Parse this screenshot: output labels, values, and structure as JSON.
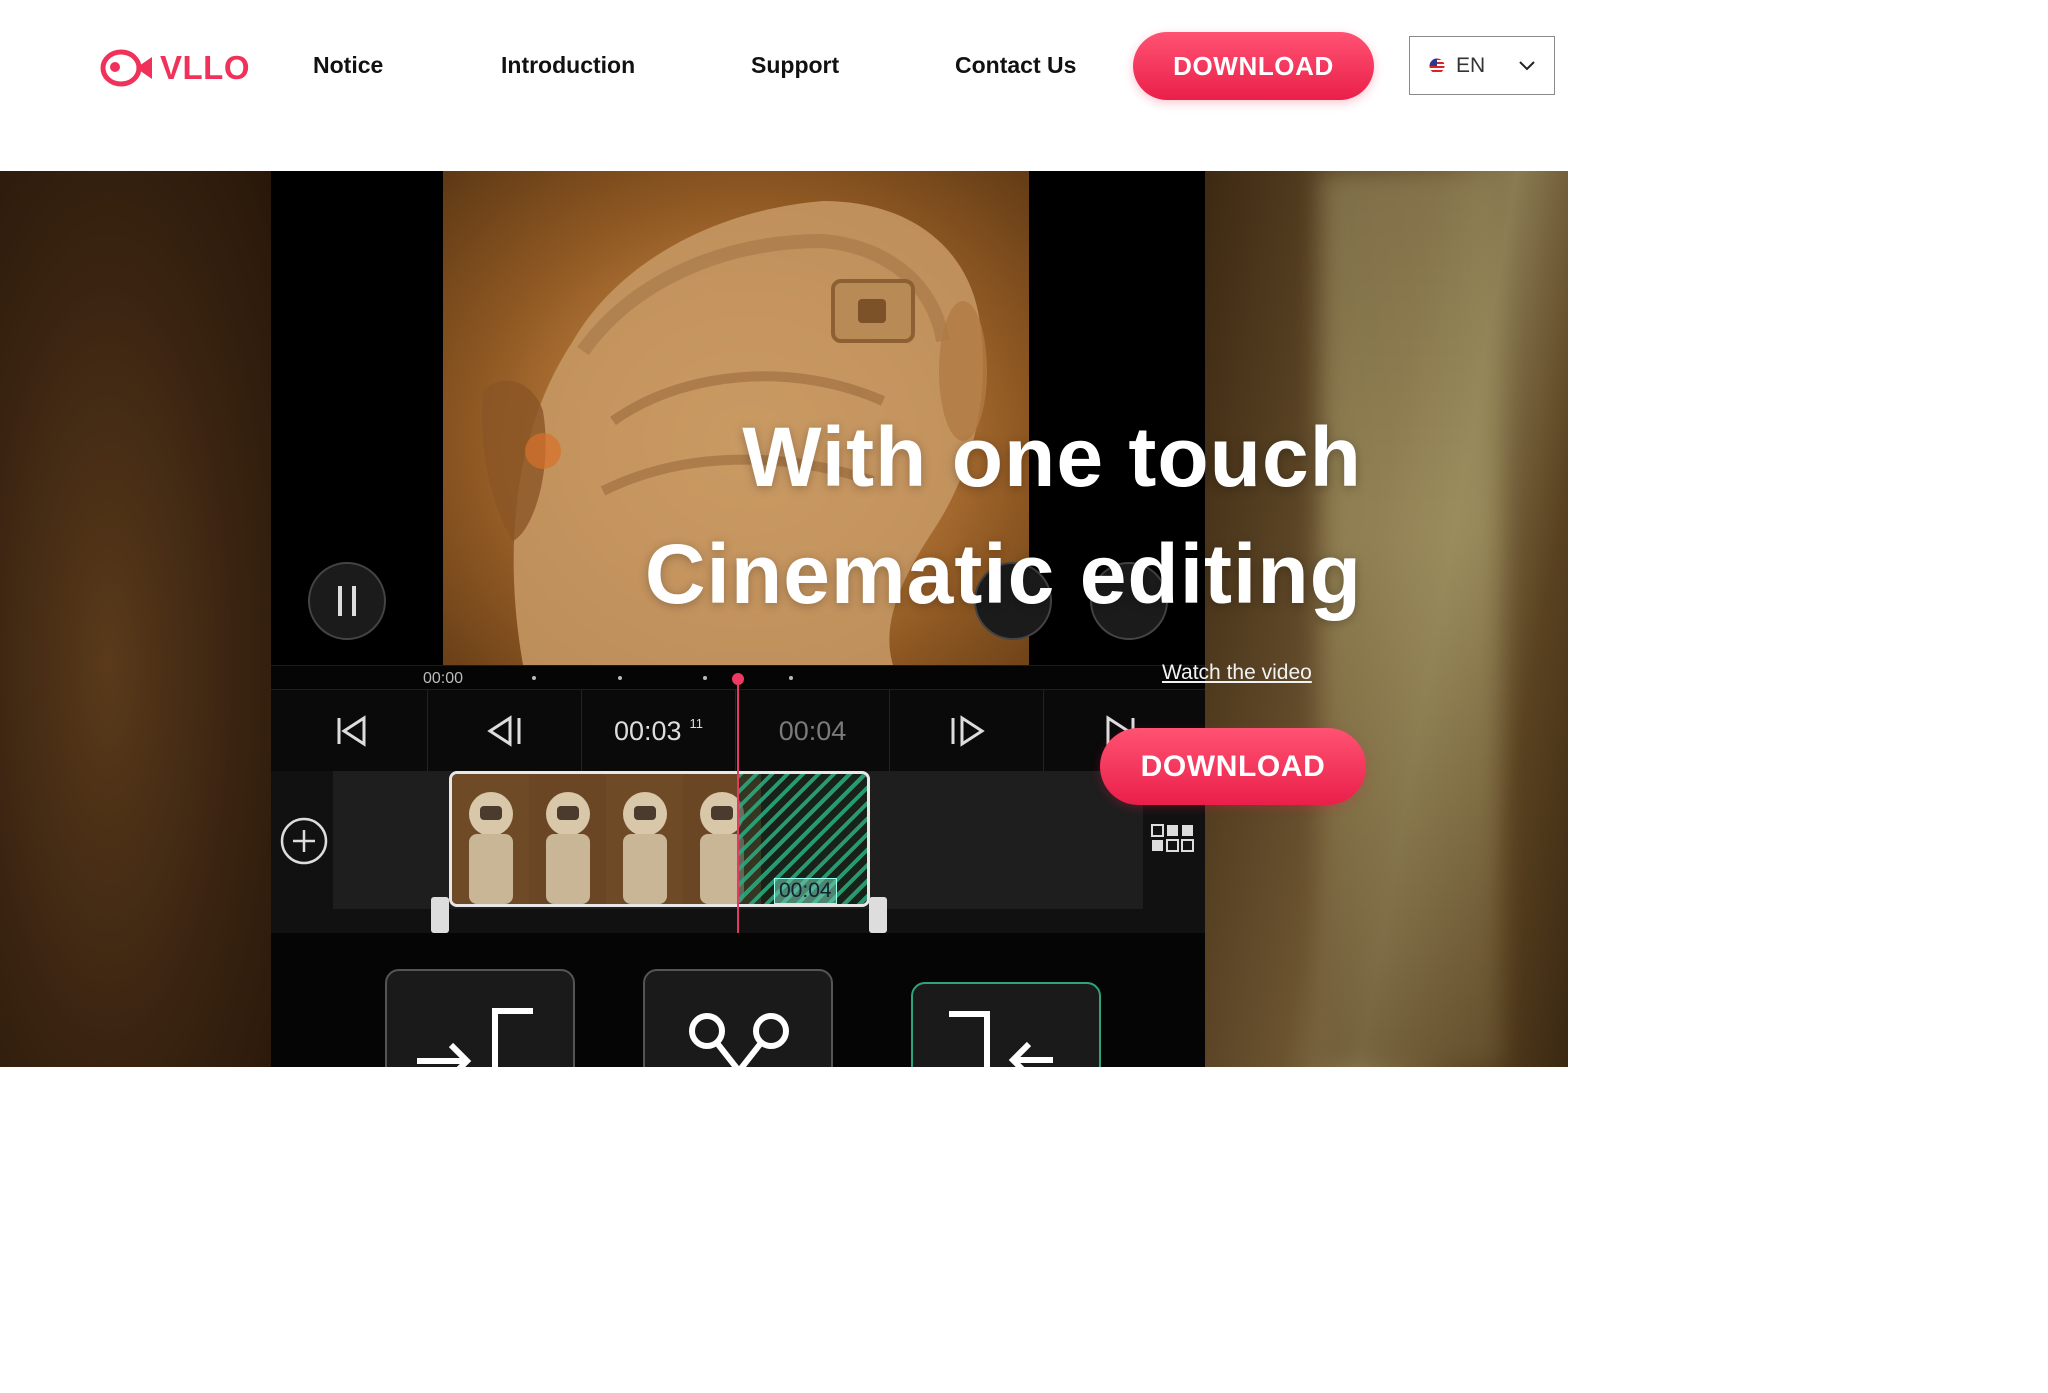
{
  "brand": {
    "name": "VLLO",
    "color": "#f0325a",
    "logo_icon": "fish-play-icon"
  },
  "nav": {
    "links": [
      "Notice",
      "Introduction",
      "Support",
      "Contact Us"
    ],
    "download_label": "DOWNLOAD",
    "language": {
      "code": "EN",
      "flag_icon": "us-flag-icon",
      "chevron_icon": "chevron-down-icon"
    }
  },
  "hero": {
    "headline_line1": "With one touch",
    "headline_line2": "Cinematic editing",
    "watch_label": "Watch the video",
    "download_label": "DOWNLOAD"
  },
  "app_preview": {
    "ruler_start": "00:00",
    "current_time": "00:03",
    "current_frame": "11",
    "next_time": "00:04",
    "clip_duration": "00:04",
    "accent_color": "#e23a63",
    "transition_color": "#2fa37a",
    "icons": [
      "pause-icon",
      "skip-to-start-icon",
      "previous-frame-icon",
      "next-frame-icon",
      "skip-to-end-icon",
      "add-clip-icon",
      "grid-icon",
      "split-tool-icon",
      "cut-tool-icon",
      "merge-tool-icon"
    ]
  }
}
